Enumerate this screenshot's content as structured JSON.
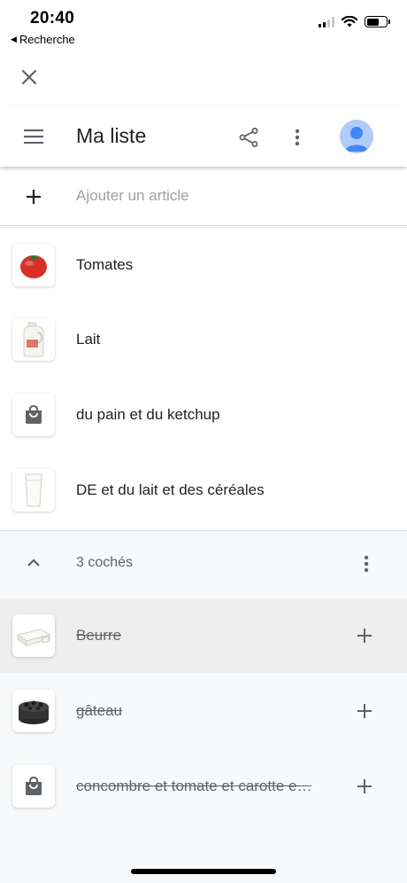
{
  "status_bar": {
    "time": "20:40",
    "back_label": "Recherche",
    "back_glyph": "◀"
  },
  "header": {
    "title": "Ma liste",
    "close_icon": "close-icon",
    "menu_icon": "hamburger-menu-icon",
    "share_icon": "share-icon",
    "more_icon": "more-vert-icon",
    "avatar_icon": "account-avatar-icon"
  },
  "add_item": {
    "plus_icon": "plus-icon",
    "label": "Ajouter un article"
  },
  "items": [
    {
      "label": "Tomates",
      "icon": "tomato-image"
    },
    {
      "label": "Lait",
      "icon": "milk-jug-image"
    },
    {
      "label": "du pain et du ketchup",
      "icon": "shopping-bag-icon"
    },
    {
      "label": "DE et du lait et des céréales",
      "icon": "milk-glass-image"
    }
  ],
  "checked": {
    "count_label": "3 cochés",
    "expanded": true,
    "items": [
      {
        "label": "Beurre",
        "icon": "butter-image",
        "highlighted": true
      },
      {
        "label": "gâteau",
        "icon": "chocolate-cake-image",
        "highlighted": false
      },
      {
        "label": "concombre et tomate et carotte e…",
        "icon": "shopping-bag-icon",
        "highlighted": false
      }
    ]
  },
  "colors": {
    "accent_avatar": "#aecbfa",
    "avatar_figure": "#4285f4",
    "tomato": "#d93025",
    "placeholder_text": "#9aa0a6",
    "checked_bg": "#f8f9fa",
    "highlight_bg": "#eeeeee"
  }
}
